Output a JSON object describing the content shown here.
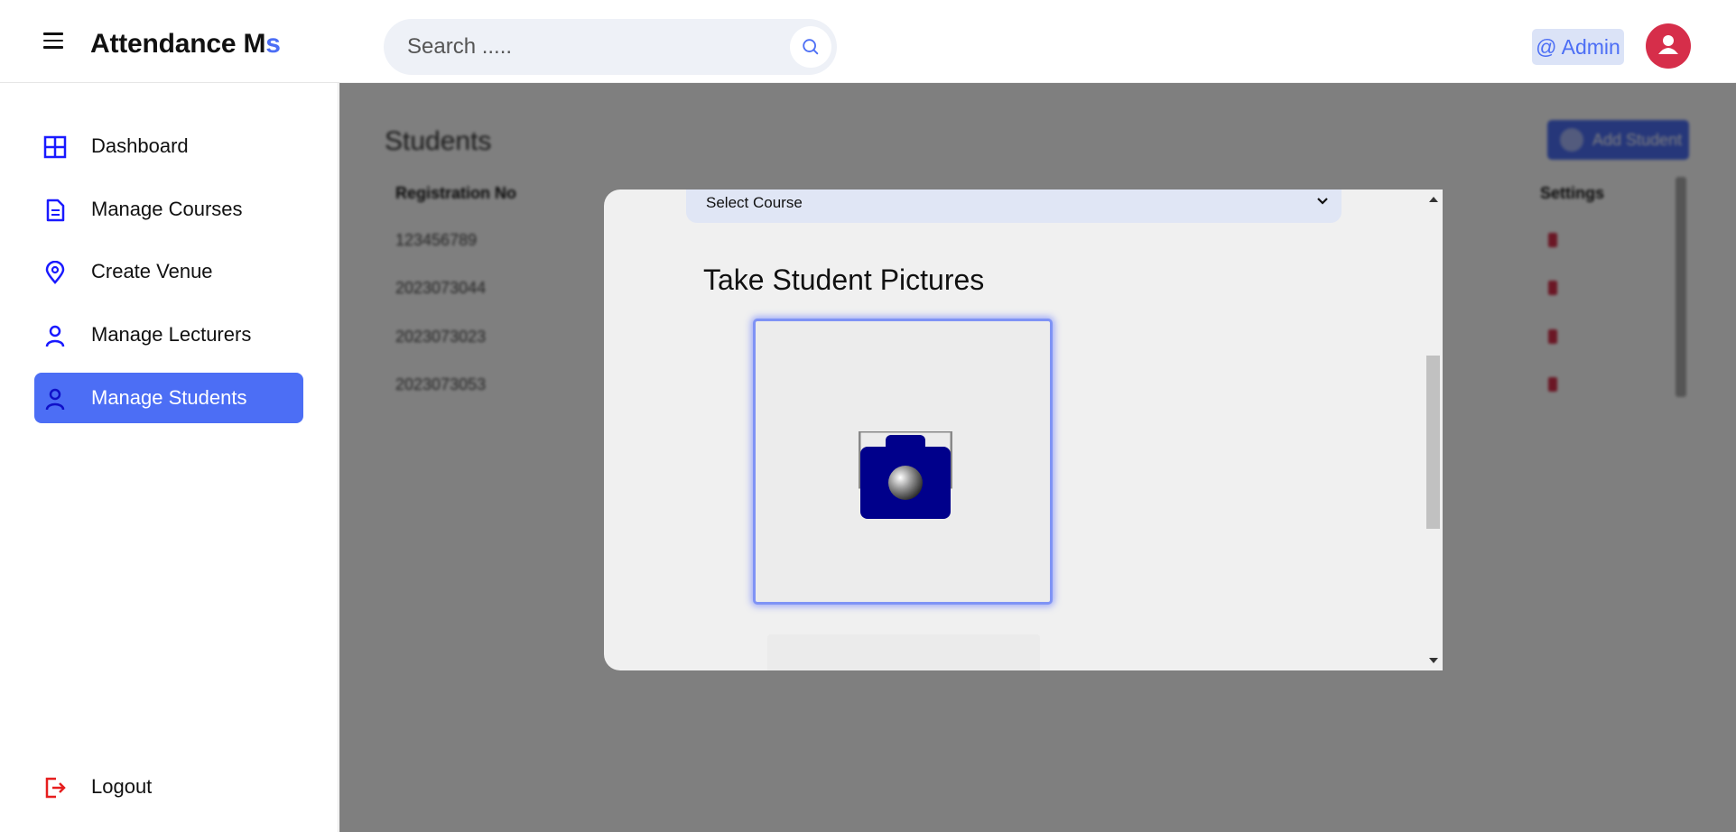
{
  "header": {
    "brand_main": "Attendance M",
    "brand_accent": "s",
    "search_placeholder": "Search .....",
    "admin_label": "@ Admin"
  },
  "sidebar": {
    "items": [
      {
        "label": "Dashboard",
        "icon": "dashboard-grid-icon",
        "active": false
      },
      {
        "label": "Manage Courses",
        "icon": "document-icon",
        "active": false
      },
      {
        "label": "Create Venue",
        "icon": "location-pin-icon",
        "active": false
      },
      {
        "label": "Manage Lecturers",
        "icon": "user-icon",
        "active": false
      },
      {
        "label": "Manage Students",
        "icon": "user-icon",
        "active": true
      }
    ],
    "logout_label": "Logout"
  },
  "background_page": {
    "title": "Students",
    "add_button": "Add Student",
    "columns": [
      "Registration No",
      "Settings"
    ],
    "rows": [
      "123456789",
      "2023073044",
      "2023073023",
      "2023073053"
    ]
  },
  "modal": {
    "select_course_value": "Select Course",
    "heading": "Take Student Pictures"
  },
  "colors": {
    "accent": "#4c6ef5",
    "danger": "#d62e4a",
    "camera": "#00008b"
  }
}
